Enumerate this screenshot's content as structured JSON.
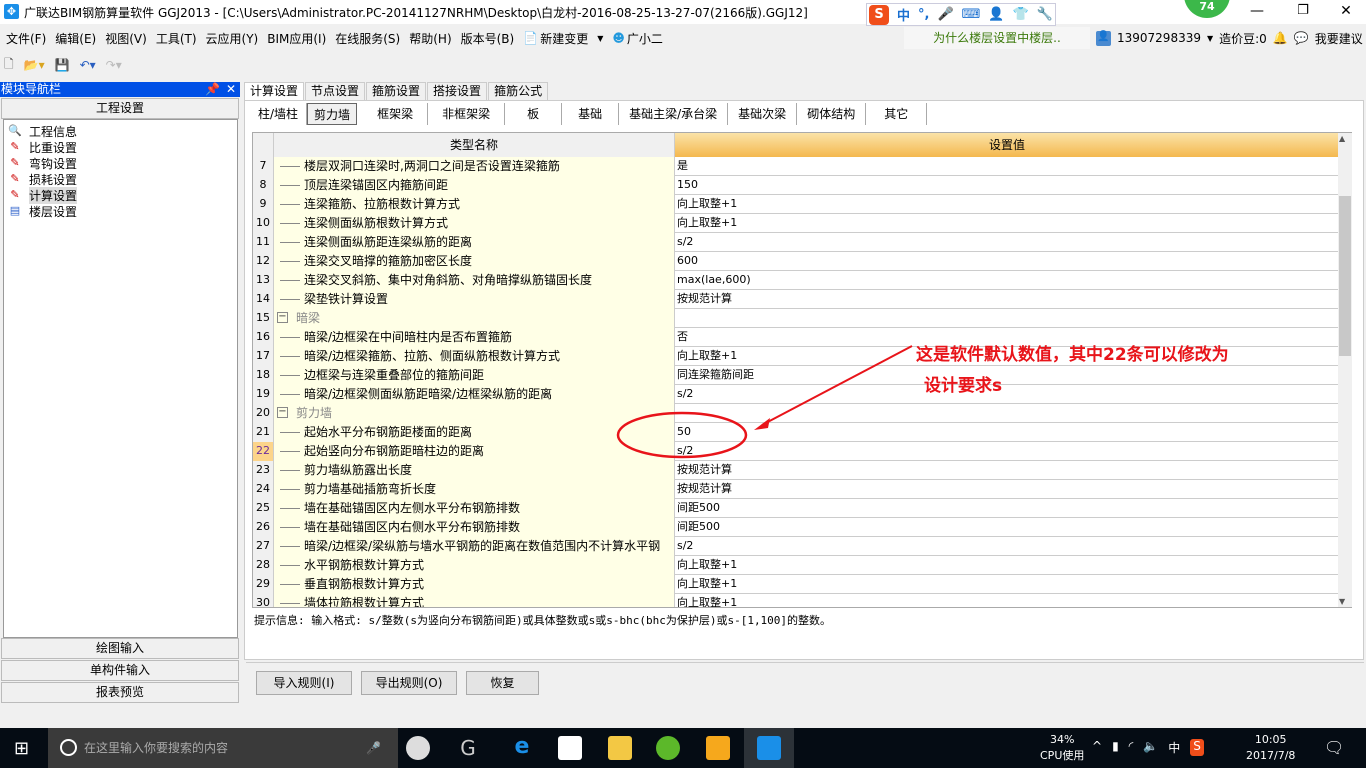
{
  "window": {
    "title": "广联达BIM钢筋算量软件 GGJ2013 - [C:\\Users\\Administrator.PC-20141127NRHM\\Desktop\\白龙村-2016-08-25-13-27-07(2166版).GGJ12]",
    "badge": "74",
    "ime": [
      "中",
      "°,",
      "🎤",
      "⌨",
      "👤",
      "👕",
      "🔧"
    ]
  },
  "menu": [
    "文件(F)",
    "编辑(E)",
    "视图(V)",
    "工具(T)",
    "云应用(Y)",
    "BIM应用(I)",
    "在线服务(S)",
    "帮助(H)",
    "版本号(B)",
    "新建变更",
    "广小二"
  ],
  "qa_link": "为什么楼层设置中楼层..",
  "user": {
    "phone": "13907298339",
    "beans": "造价豆:0",
    "suggest": "我要建议"
  },
  "nav": {
    "title": "模块导航栏",
    "section": "工程设置",
    "items": [
      "工程信息",
      "比重设置",
      "弯钩设置",
      "损耗设置",
      "计算设置",
      "楼层设置"
    ],
    "selected": 4,
    "bottom": [
      "绘图输入",
      "单构件输入",
      "报表预览"
    ]
  },
  "tabs": [
    "计算设置",
    "节点设置",
    "箍筋设置",
    "搭接设置",
    "箍筋公式"
  ],
  "subtabs": [
    "柱/墙柱",
    "剪力墙",
    "框架梁",
    "非框架梁",
    "板",
    "基础",
    "基础主梁/承台梁",
    "基础次梁",
    "砌体结构",
    "其它"
  ],
  "grid": {
    "headers": [
      "类型名称",
      "设置值"
    ],
    "current_row": 22,
    "rows": [
      {
        "n": "7",
        "name": "楼层双洞口连梁时,两洞口之间是否设置连梁箍筋",
        "value": "是"
      },
      {
        "n": "8",
        "name": "顶层连梁锚固区内箍筋间距",
        "value": "150"
      },
      {
        "n": "9",
        "name": "连梁箍筋、拉筋根数计算方式",
        "value": "向上取整+1"
      },
      {
        "n": "10",
        "name": "连梁侧面纵筋根数计算方式",
        "value": "向上取整+1"
      },
      {
        "n": "11",
        "name": "连梁侧面纵筋距连梁纵筋的距离",
        "value": "s/2"
      },
      {
        "n": "12",
        "name": "连梁交叉暗撑的箍筋加密区长度",
        "value": "600"
      },
      {
        "n": "13",
        "name": "连梁交叉斜筋、集中对角斜筋、对角暗撑纵筋锚固长度",
        "value": "max(lae,600)"
      },
      {
        "n": "14",
        "name": "梁垫铁计算设置",
        "value": "按规范计算"
      },
      {
        "n": "15",
        "name": "暗梁",
        "value": "",
        "group": true
      },
      {
        "n": "16",
        "name": "暗梁/边框梁在中间暗柱内是否布置箍筋",
        "value": "否"
      },
      {
        "n": "17",
        "name": "暗梁/边框梁箍筋、拉筋、侧面纵筋根数计算方式",
        "value": "向上取整+1"
      },
      {
        "n": "18",
        "name": "边框梁与连梁重叠部位的箍筋间距",
        "value": "同连梁箍筋间距"
      },
      {
        "n": "19",
        "name": "暗梁/边框梁侧面纵筋距暗梁/边框梁纵筋的距离",
        "value": "s/2"
      },
      {
        "n": "20",
        "name": "剪力墙",
        "value": "",
        "group": true
      },
      {
        "n": "21",
        "name": "起始水平分布钢筋距楼面的距离",
        "value": "50"
      },
      {
        "n": "22",
        "name": "起始竖向分布钢筋距暗柱边的距离",
        "value": "s/2"
      },
      {
        "n": "23",
        "name": "剪力墙纵筋露出长度",
        "value": "按规范计算"
      },
      {
        "n": "24",
        "name": "剪力墙基础插筋弯折长度",
        "value": "按规范计算"
      },
      {
        "n": "25",
        "name": "墙在基础锚固区内左侧水平分布钢筋排数",
        "value": "间距500"
      },
      {
        "n": "26",
        "name": "墙在基础锚固区内右侧水平分布钢筋排数",
        "value": "间距500"
      },
      {
        "n": "27",
        "name": "暗梁/边框梁/梁纵筋与墙水平钢筋的距离在数值范围内不计算水平钢",
        "value": "s/2"
      },
      {
        "n": "28",
        "name": "水平钢筋根数计算方式",
        "value": "向上取整+1"
      },
      {
        "n": "29",
        "name": "垂直钢筋根数计算方式",
        "value": "向上取整+1"
      },
      {
        "n": "30",
        "name": "墙体拉筋根数计算方式",
        "value": "向上取整+1"
      }
    ]
  },
  "hint": "提示信息: 输入格式: s/整数(s为竖向分布钢筋间距)或具体整数或s或s-bhc(bhc为保护层)或s-[1,100]的整数。",
  "buttons": {
    "import": "导入规则(I)",
    "export": "导出规则(O)",
    "restore": "恢复"
  },
  "annotation": {
    "line1": "这是软件默认数值，其中22条可以修改为",
    "line2": "设计要求s",
    "color": "#e8141a"
  },
  "taskbar": {
    "search_placeholder": "在这里输入你要搜索的内容",
    "cpu_percent": "34%",
    "cpu_label": "CPU使用",
    "ime": "中",
    "time": "10:05",
    "date": "2017/7/8"
  }
}
